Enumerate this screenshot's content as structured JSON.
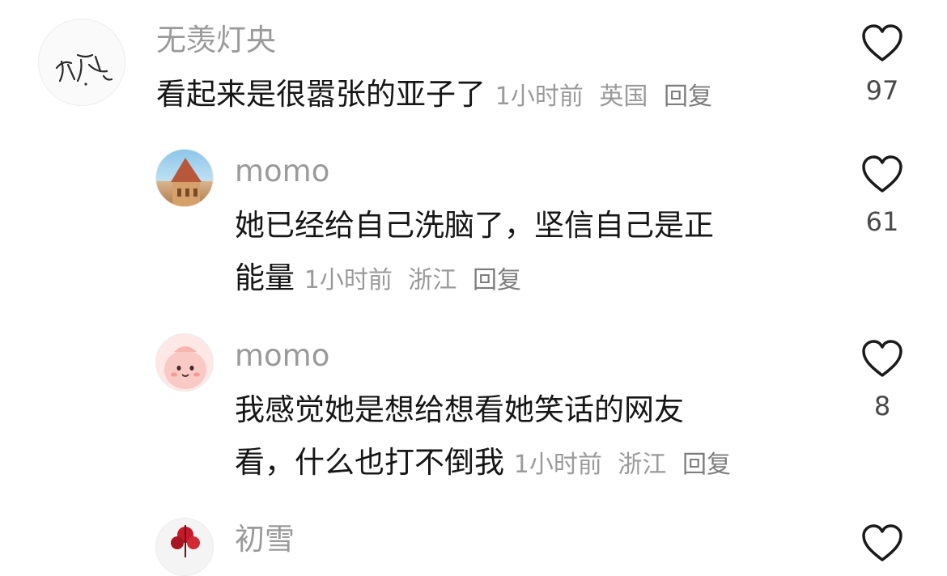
{
  "comments": [
    {
      "username": "无羡灯央",
      "text": "看起来是很嚣张的亚子了",
      "time": "1小时前",
      "location": "英国",
      "reply": "回复",
      "likes": "97",
      "avatar": "calligraphy-avatar"
    },
    {
      "username": "momo",
      "text_line1": "她已经给自己洗脑了，坚信自己是正",
      "text_line2": "能量",
      "time": "1小时前",
      "location": "浙江",
      "reply": "回复",
      "likes": "61",
      "avatar": "building-avatar"
    },
    {
      "username": "momo",
      "text_line1": "我感觉她是想给想看她笑话的网友",
      "text_line2": "看，什么也打不倒我",
      "time": "1小时前",
      "location": "浙江",
      "reply": "回复",
      "likes": "8",
      "avatar": "cartoon-pink-avatar"
    },
    {
      "username": "初雪",
      "avatar": "red-flower-avatar"
    }
  ],
  "colors": {
    "username": "#9a9a9a",
    "text": "#161616",
    "meta": "#9a9a9a",
    "heart_stroke": "#1a1a1a"
  }
}
